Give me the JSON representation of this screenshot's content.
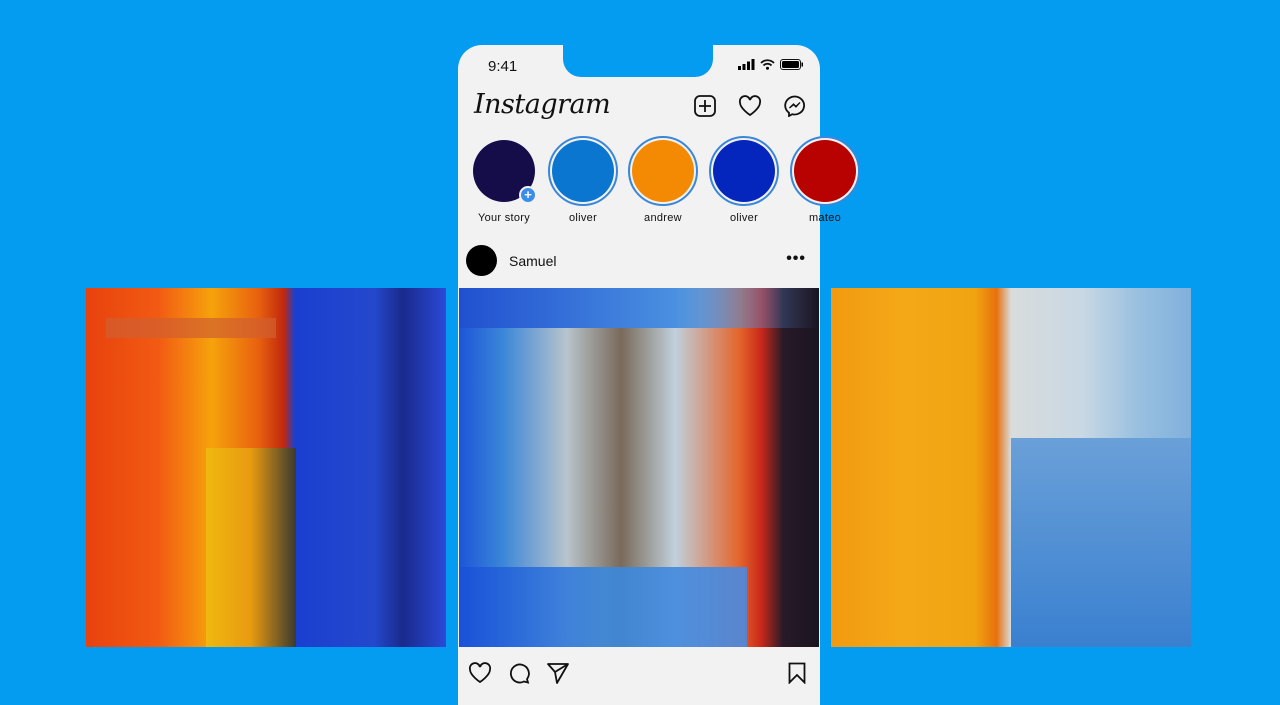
{
  "status_bar": {
    "time": "9:41"
  },
  "header": {
    "logo": "Instagram",
    "icons": [
      "new-post-icon",
      "heart-icon",
      "messenger-icon"
    ]
  },
  "stories": [
    {
      "label": "Your story",
      "color": "#150c4a",
      "own": true,
      "badge": "+"
    },
    {
      "label": "oliver",
      "color": "#0a76d0"
    },
    {
      "label": "andrew",
      "color": "#f48a04"
    },
    {
      "label": "oliver",
      "color": "#0526bc"
    },
    {
      "label": "mateo",
      "color": "#b80202"
    }
  ],
  "post": {
    "author": "Samuel",
    "more": "•••",
    "actions": [
      "like-icon",
      "comment-icon",
      "share-icon"
    ],
    "save": "bookmark-icon"
  },
  "colors": {
    "background": "#049cf0",
    "phone": "#f2f2f2",
    "story_ring": "#3a86d8"
  }
}
